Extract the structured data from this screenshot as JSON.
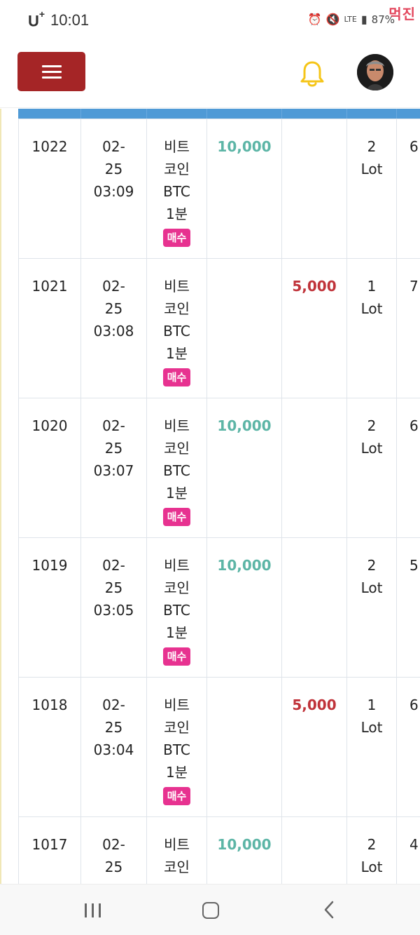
{
  "status_bar": {
    "carrier": "U",
    "carrier_plus": "+",
    "time": "10:01",
    "network": "LTE",
    "battery": "87%",
    "watermark": "먹진"
  },
  "header": {
    "menu_icon": "hamburger-menu-icon",
    "bell_icon": "bell-icon",
    "accent_color": "#a52526",
    "bell_color": "#f5c518"
  },
  "table": {
    "header_color": "#4f9ad6",
    "rows": [
      {
        "id": "1022",
        "date": "02-",
        "day": "25",
        "time": "03:09",
        "sym1": "비트",
        "sym2": "코인",
        "sym3": "BTC",
        "sym4": "1분",
        "side": "매수",
        "buy_amount": "10,000",
        "sell_amount": "",
        "lot_qty": "2",
        "lot_unit": "Lot",
        "extra": "6"
      },
      {
        "id": "1021",
        "date": "02-",
        "day": "25",
        "time": "03:08",
        "sym1": "비트",
        "sym2": "코인",
        "sym3": "BTC",
        "sym4": "1분",
        "side": "매수",
        "buy_amount": "",
        "sell_amount": "5,000",
        "lot_qty": "1",
        "lot_unit": "Lot",
        "extra": "7"
      },
      {
        "id": "1020",
        "date": "02-",
        "day": "25",
        "time": "03:07",
        "sym1": "비트",
        "sym2": "코인",
        "sym3": "BTC",
        "sym4": "1분",
        "side": "매수",
        "buy_amount": "10,000",
        "sell_amount": "",
        "lot_qty": "2",
        "lot_unit": "Lot",
        "extra": "6"
      },
      {
        "id": "1019",
        "date": "02-",
        "day": "25",
        "time": "03:05",
        "sym1": "비트",
        "sym2": "코인",
        "sym3": "BTC",
        "sym4": "1분",
        "side": "매수",
        "buy_amount": "10,000",
        "sell_amount": "",
        "lot_qty": "2",
        "lot_unit": "Lot",
        "extra": "5"
      },
      {
        "id": "1018",
        "date": "02-",
        "day": "25",
        "time": "03:04",
        "sym1": "비트",
        "sym2": "코인",
        "sym3": "BTC",
        "sym4": "1분",
        "side": "매수",
        "buy_amount": "",
        "sell_amount": "5,000",
        "lot_qty": "1",
        "lot_unit": "Lot",
        "extra": "6"
      },
      {
        "id": "1017",
        "date": "02-",
        "day": "25",
        "time": "",
        "sym1": "비트",
        "sym2": "코인",
        "sym3": "",
        "sym4": "",
        "side": "",
        "buy_amount": "10,000",
        "sell_amount": "",
        "lot_qty": "2",
        "lot_unit": "Lot",
        "extra": "4"
      }
    ]
  },
  "nav": {
    "recent_icon": "recent-apps-icon",
    "home_icon": "home-icon",
    "back_icon": "back-icon"
  }
}
